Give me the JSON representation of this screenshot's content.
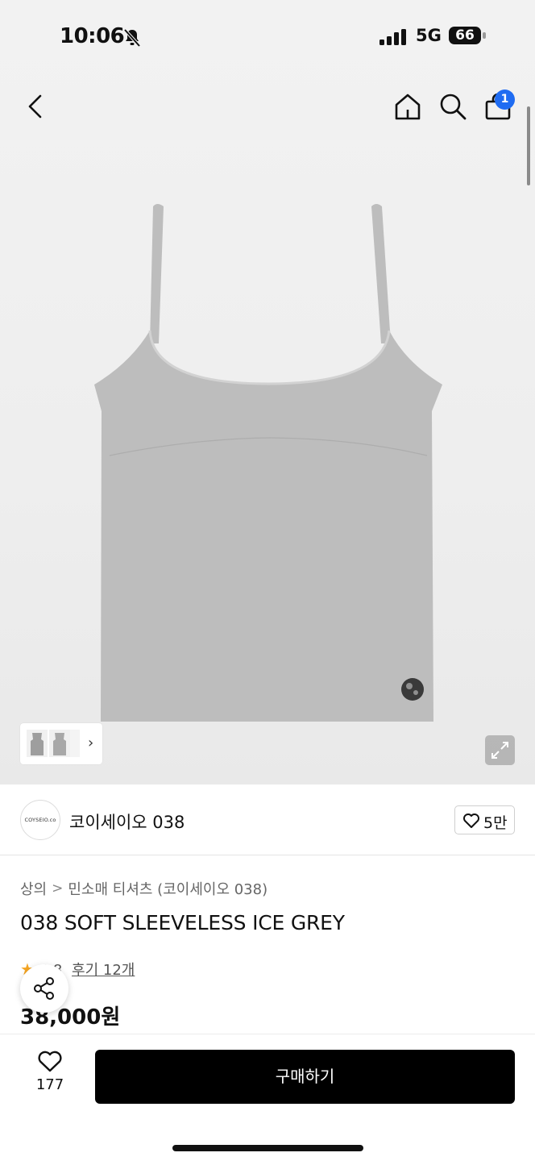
{
  "status_bar": {
    "time": "10:06",
    "network": "5G",
    "battery": "66"
  },
  "header": {
    "cart_count": "1"
  },
  "gallery": {
    "thumbnail_next": "›"
  },
  "brand": {
    "logo_text": "COYSEIO.co",
    "name": "코이세이오 038",
    "likes": "5만"
  },
  "breadcrumb": {
    "category": "상의",
    "separator": ">",
    "subcategory": "민소매 티셔츠 (코이세이오 038)"
  },
  "product": {
    "title": "038 SOFT SLEEVELESS ICE GREY",
    "rating_star": "★",
    "rating": "4.8",
    "reviews": "후기 12개",
    "price": "38,000원"
  },
  "bottom_bar": {
    "wish_count": "177",
    "buy_label": "구매하기"
  },
  "colors": {
    "accent_blue": "#1f6cf2",
    "star": "#f6a623",
    "buy_button": "#000000",
    "garment": "#bdbdbd"
  }
}
